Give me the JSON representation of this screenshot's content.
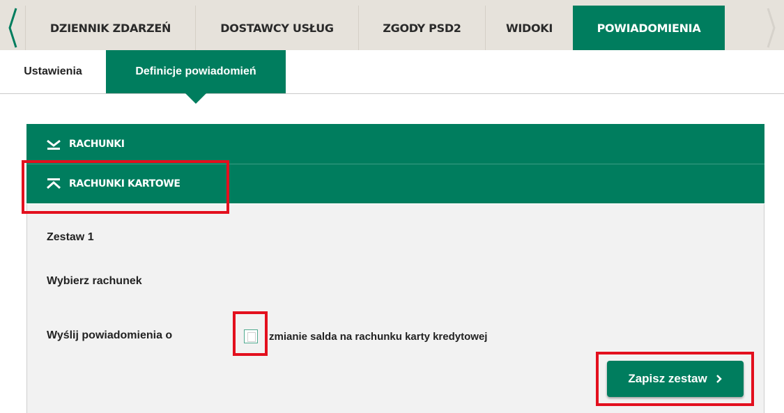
{
  "top_tabs": [
    {
      "label": "DZIENNIK ZDARZEŃ"
    },
    {
      "label": "DOSTAWCY USŁUG"
    },
    {
      "label": "ZGODY PSD2"
    },
    {
      "label": "WIDOKI"
    },
    {
      "label": "POWIADOMIENIA"
    }
  ],
  "sub_tabs": [
    {
      "label": "Ustawienia"
    },
    {
      "label": "Definicje powiadomień"
    }
  ],
  "accordion": [
    {
      "label": "RACHUNKI",
      "icon": "chevron-down-icon"
    },
    {
      "label": "RACHUNKI KARTOWE",
      "icon": "chevron-up-icon"
    }
  ],
  "panel": {
    "set_title": "Zestaw 1",
    "choose_account_label": "Wybierz rachunek",
    "send_label": "Wyślij powiadomienia o",
    "checkbox_label": "zmianie salda na rachunku karty kredytowej",
    "checkbox_checked": false,
    "save_label": "Zapisz zestaw"
  },
  "colors": {
    "brand_green": "#007d5e",
    "tab_bg": "#e6e2db",
    "highlight_red": "#e3101e"
  }
}
